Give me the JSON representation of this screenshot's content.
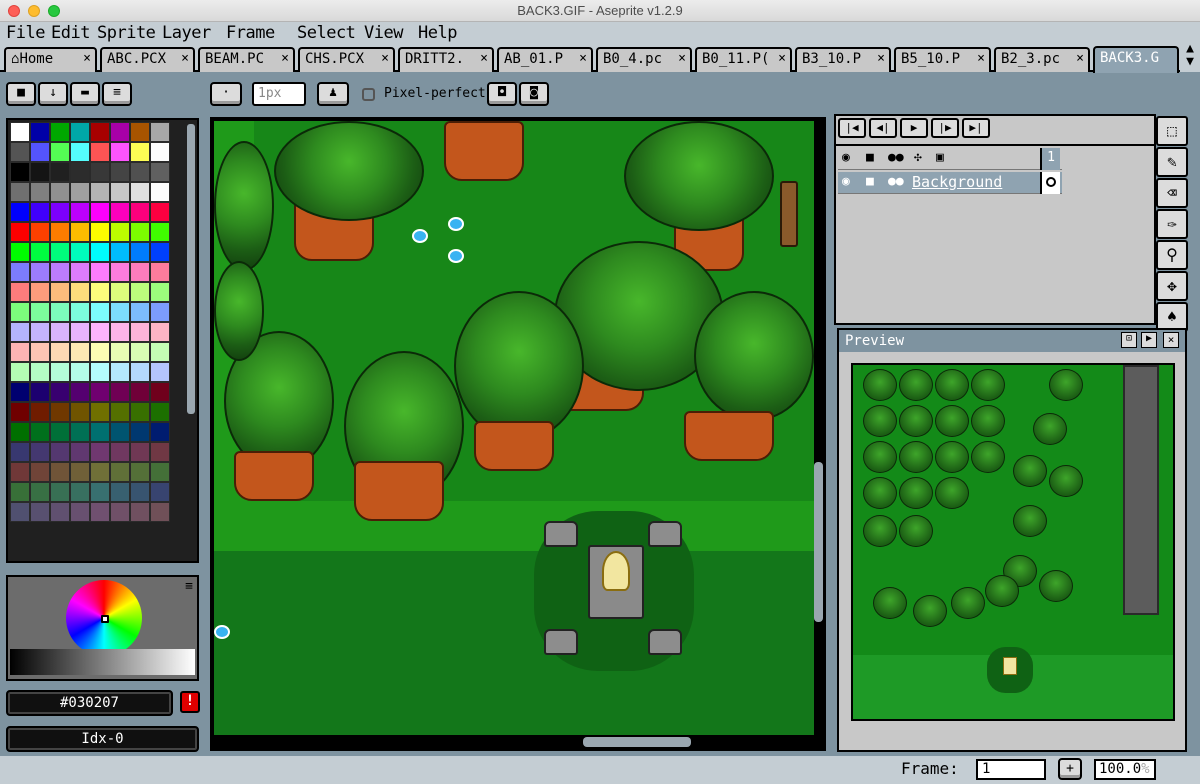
{
  "window": {
    "title": "BACK3.GIF - Aseprite v1.2.9"
  },
  "menu": [
    "File",
    "Edit",
    "Sprite",
    "Layer",
    "Frame",
    "Select",
    "View",
    "Help"
  ],
  "tabs": [
    {
      "label": "Home",
      "close": "×"
    },
    {
      "label": "ABC.PCX",
      "close": "×"
    },
    {
      "label": "BEAM.PC",
      "close": "×"
    },
    {
      "label": "CHS.PCX",
      "close": "×"
    },
    {
      "label": "DRITT2.",
      "close": "×"
    },
    {
      "label": "AB_01.P",
      "close": "×"
    },
    {
      "label": "B0_4.pc",
      "close": "×"
    },
    {
      "label": "B0_11.P(",
      "close": "×"
    },
    {
      "label": "B3_10.P",
      "close": "×"
    },
    {
      "label": "B5_10.P",
      "close": "×"
    },
    {
      "label": "B2_3.pc",
      "close": "×"
    },
    {
      "label": "BACK3.G",
      "close": ""
    }
  ],
  "toolbar": {
    "brush_size": "1px",
    "pixel_perfect_label": "Pixel-perfect",
    "pixel_perfect_checked": false
  },
  "palette_colors": [
    "#ffffff",
    "#0000a8",
    "#00a800",
    "#00a8a8",
    "#a80000",
    "#a800a8",
    "#a85400",
    "#a8a8a8",
    "#545454",
    "#5454fc",
    "#54fc54",
    "#54fcfc",
    "#fc5454",
    "#fc54fc",
    "#fcfc54",
    "#fcfcfc",
    "#000000",
    "#141414",
    "#202020",
    "#2c2c2c",
    "#383838",
    "#444444",
    "#505050",
    "#606060",
    "#707070",
    "#808080",
    "#909090",
    "#a0a0a0",
    "#b4b4b4",
    "#c8c8c8",
    "#e0e0e0",
    "#fcfcfc",
    "#0000fc",
    "#4000fc",
    "#7c00fc",
    "#bc00fc",
    "#fc00fc",
    "#fc00bc",
    "#fc007c",
    "#fc0040",
    "#fc0000",
    "#fc4000",
    "#fc7c00",
    "#fcbc00",
    "#fcfc00",
    "#bcfc00",
    "#7cfc00",
    "#40fc00",
    "#00fc00",
    "#00fc40",
    "#00fc7c",
    "#00fcbc",
    "#00fcfc",
    "#00bcfc",
    "#007cfc",
    "#0040fc",
    "#7c7cfc",
    "#9c7cfc",
    "#bc7cfc",
    "#dc7cfc",
    "#fc7cfc",
    "#fc7cdc",
    "#fc7cbc",
    "#fc7c9c",
    "#fc7c7c",
    "#fc9c7c",
    "#fcbc7c",
    "#fcdc7c",
    "#fcfc7c",
    "#dcfc7c",
    "#bcfc7c",
    "#9cfc7c",
    "#7cfc7c",
    "#7cfc9c",
    "#7cfcbc",
    "#7cfcdc",
    "#7cfcfc",
    "#7cdcfc",
    "#7cbcfc",
    "#7c9cfc",
    "#b4b4fc",
    "#c4b4fc",
    "#d8b4fc",
    "#e8b4fc",
    "#fcb4fc",
    "#fcb4e8",
    "#fcb4d8",
    "#fcb4c4",
    "#fcb4b4",
    "#fcc4b4",
    "#fcd8b4",
    "#fce8b4",
    "#fcfcb4",
    "#e8fcb4",
    "#d8fcb4",
    "#c4fcb4",
    "#b4fcb4",
    "#b4fcc4",
    "#b4fcd8",
    "#b4fce8",
    "#b4fcfc",
    "#b4e8fc",
    "#b4d8fc",
    "#b4c4fc",
    "#000070",
    "#1c0070",
    "#380070",
    "#540070",
    "#700070",
    "#700054",
    "#700038",
    "#70001c",
    "#700000",
    "#701c00",
    "#703800",
    "#705400",
    "#707000",
    "#547000",
    "#387000",
    "#1c7000",
    "#007000",
    "#00701c",
    "#007038",
    "#007054",
    "#007070",
    "#005470",
    "#003870",
    "#001c70",
    "#383870",
    "#443870",
    "#543870",
    "#603870",
    "#703870",
    "#703860",
    "#703854",
    "#703844",
    "#703838",
    "#704438",
    "#705438",
    "#706038",
    "#707038",
    "#607038",
    "#547038",
    "#447038",
    "#387038",
    "#387044",
    "#387054",
    "#387060",
    "#387070",
    "#386070",
    "#385470",
    "#384470",
    "#505070",
    "#585070",
    "#605070",
    "#685070",
    "#705070",
    "#705068",
    "#705060",
    "#705058"
  ],
  "color": {
    "hex": "#030207",
    "index_label": "Idx-0",
    "warning": "!"
  },
  "timeline": {
    "frame_number": "1",
    "layer_name": "Background"
  },
  "preview": {
    "title": "Preview"
  },
  "status": {
    "frame_label": "Frame:",
    "frame_value": "1",
    "add_frame": "+",
    "zoom": "100.0",
    "zoom_unit": "%"
  },
  "colors": {
    "grass": "#1f9a1a",
    "dark_grass": "#13771a",
    "trunk": "#c3561c",
    "panel": "#c8c8c8",
    "chrome": "#7e93a0"
  }
}
